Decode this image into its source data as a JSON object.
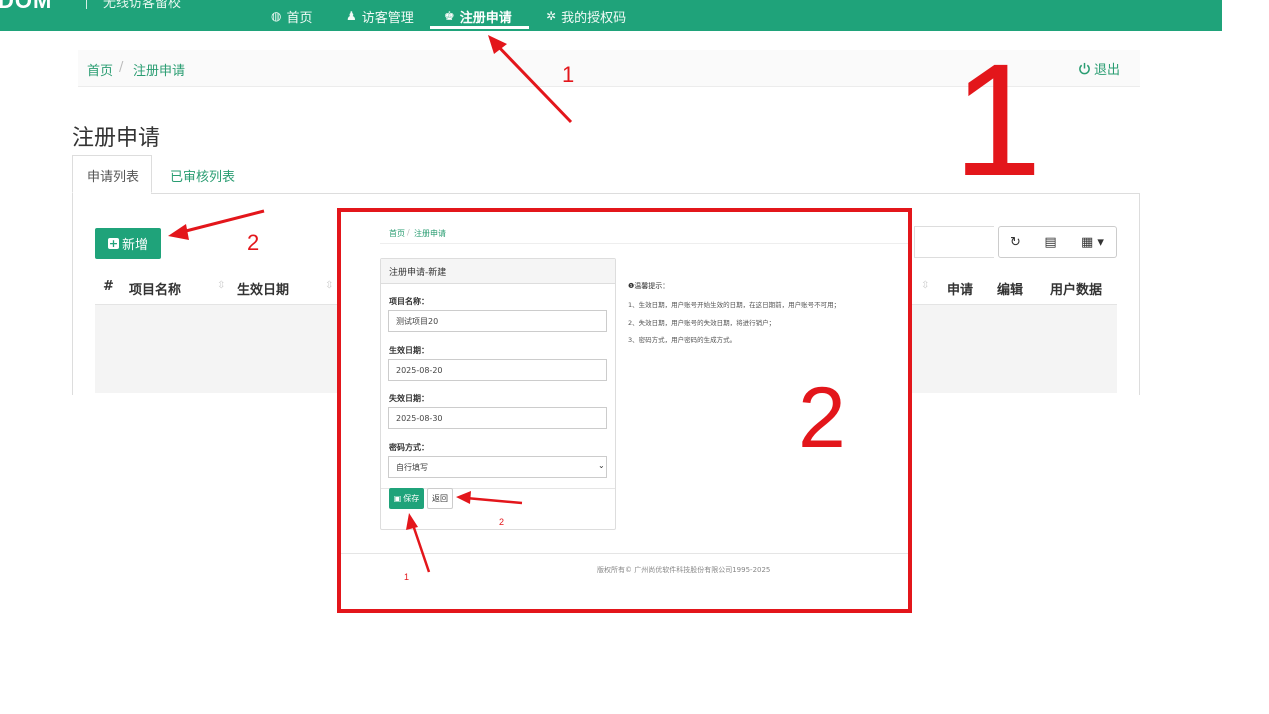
{
  "nav": {
    "brand": "DOM",
    "brand_sub": "无线访客留校",
    "items": [
      {
        "icon": "dashboard-icon",
        "label": "首页"
      },
      {
        "icon": "user-icon",
        "label": "访客管理"
      },
      {
        "icon": "users-icon",
        "label": "注册申请"
      },
      {
        "icon": "gear-icon",
        "label": "我的授权码"
      }
    ]
  },
  "breadcrumb": {
    "home": "首页",
    "sep": "/",
    "current": "注册申请"
  },
  "logout_label": "退出",
  "page_title": "注册申请",
  "tabs": [
    "申请列表",
    "已审核列表"
  ],
  "toolbar": {
    "new_label": "新增"
  },
  "table": {
    "columns_left": [
      "#",
      "项目名称",
      "生效日期"
    ],
    "columns_right": [
      "申请",
      "编辑",
      "用户数据"
    ]
  },
  "overlay": {
    "breadcrumb": {
      "home": "首页",
      "sep": "/",
      "current": "注册申请"
    },
    "form_title": "注册申请-新建",
    "fields": [
      {
        "label": "项目名称：",
        "value": "测试项目20"
      },
      {
        "label": "生效日期：",
        "value": "2025-08-20"
      },
      {
        "label": "失效日期：",
        "value": "2025-08-30"
      },
      {
        "label": "密码方式：",
        "value": "自行填写"
      }
    ],
    "save_label": "保存",
    "back_label": "返回",
    "tips_title": "❶温馨提示：",
    "tips": [
      "1、生效日期，用户账号开始生效的日期，在这日期前，用户账号不可用；",
      "2、失效日期，用户账号的失效日期，将进行销户；",
      "3、密码方式，用户密码的生成方式。"
    ],
    "footer": "版权所有© 广州尚优软件科技股份有限公司1995-2025"
  },
  "annotations": {
    "big1": "1",
    "big2": "2",
    "nav_num": "1",
    "new_num": "2",
    "save_num": "1",
    "back_num": "2"
  },
  "colors": {
    "accent": "#1fa37a",
    "annotation": "#e3161b"
  }
}
